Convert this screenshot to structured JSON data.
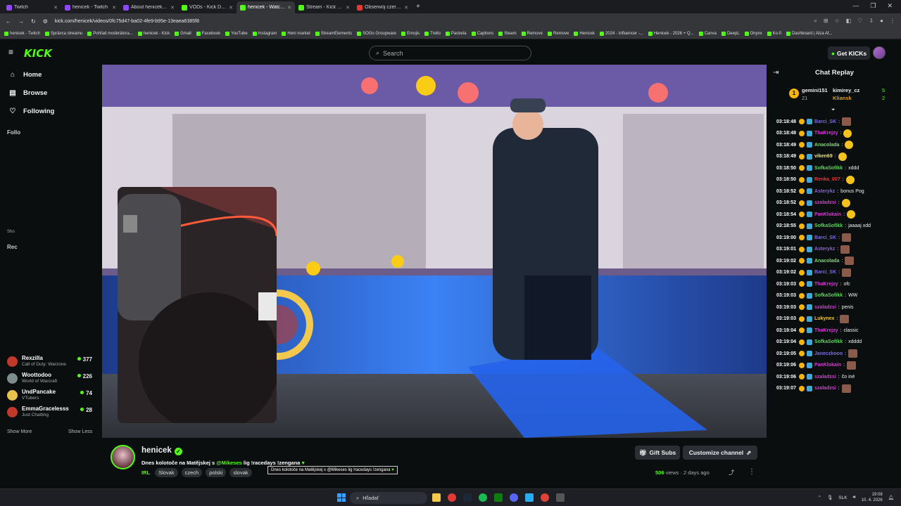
{
  "browser": {
    "tabs": [
      {
        "label": "Twitch",
        "color": "#9146ff"
      },
      {
        "label": "henicek - Twitch",
        "color": "#9146ff"
      },
      {
        "label": "About henicek - Watch Li",
        "color": "#9146ff"
      },
      {
        "label": "VODs - Kick Dashboard",
        "color": "#53fc18"
      },
      {
        "label": "henicek - Watch the V",
        "color": "#53fc18",
        "active": true
      },
      {
        "label": "Stream - Kick Dashboard",
        "color": "#53fc18"
      },
      {
        "label": "Obserwój czerwoną kropi",
        "color": "#e53935"
      }
    ],
    "url": "kick.com/henicek/videos/0fc75d47-ba02-4fe9-b95e-13eaea6385f8",
    "bookmarks": [
      "henicek - Twitch",
      "Správca streamu",
      "Pohľad moderátora...",
      "henicek - Kick",
      "Gmail",
      "Facebook",
      "YouTube",
      "Instagram",
      "Heni market",
      "StreamElements",
      "SOGo Groupware",
      "Emojis",
      "Trello",
      "Packeta",
      "Captions",
      "Steam",
      "Remove",
      "Remove",
      "Henicek",
      "2024 - Influencer -...",
      "Henicek - 2026 + Q...",
      "Canva",
      "DeepL",
      "Onyxx",
      "Ko-fi",
      "Dashboard | Alza Af..."
    ]
  },
  "header": {
    "logo": "KICK",
    "search_placeholder": "Search",
    "get_kicks_label": "Get KICKs"
  },
  "sidebar": {
    "nav": [
      {
        "label": "Home",
        "icon": "home-icon"
      },
      {
        "label": "Browse",
        "icon": "browse-icon"
      },
      {
        "label": "Following",
        "icon": "heart-icon"
      }
    ],
    "following_header": "Follo",
    "recommended_header": "Rec",
    "show_short": "Sho",
    "channels": [
      {
        "name": "Rexzilla",
        "game": "Call of Duty: Warzone",
        "viewers": "377",
        "color": "#c0392b"
      },
      {
        "name": "Woottodoo",
        "game": "World of Warcraft",
        "viewers": "226",
        "color": "#7f8c8d"
      },
      {
        "name": "UndPancake",
        "game": "VTubers",
        "viewers": "74",
        "color": "#e6c34a"
      },
      {
        "name": "EmmaGracelesss",
        "game": "Just Chatting",
        "viewers": "28",
        "color": "#c0392b"
      }
    ],
    "show_more": "Show More",
    "show_less": "Show Less"
  },
  "chat": {
    "title": "Chat Replay",
    "leader": {
      "top_name": "gemini151",
      "top_count": "21",
      "second": "kimirey_cz",
      "second_count": "5",
      "third": "Kliansk",
      "third_count": "2"
    },
    "messages": [
      {
        "time": "03:18:48",
        "user": "Barci_SK",
        "text": "",
        "color": "#7b68ee",
        "emote": "face"
      },
      {
        "time": "03:18:48",
        "user": "ThaKrejzy",
        "text": "",
        "color": "#d33dd3",
        "emote": "yellow"
      },
      {
        "time": "03:18:49",
        "user": "Anacolada",
        "text": "",
        "color": "#6ee05f",
        "emote": "yellow"
      },
      {
        "time": "03:18:49",
        "user": "viken69",
        "text": "",
        "color": "#e8e16b",
        "emote": "yellow"
      },
      {
        "time": "03:18:50",
        "user": "SofkaSofikk",
        "text": "xddd",
        "color": "#5fd35f",
        "emote": ""
      },
      {
        "time": "03:18:50",
        "user": "Renka_007",
        "text": "",
        "color": "#e53935",
        "emote": "yellow"
      },
      {
        "time": "03:18:52",
        "user": "Asterykz",
        "text": "bonus Pog",
        "color": "#8a63d2",
        "emote": ""
      },
      {
        "time": "03:18:52",
        "user": "szaladzsi",
        "text": "",
        "color": "#d33dd3",
        "emote": "yellow"
      },
      {
        "time": "03:18:54",
        "user": "PanKlokain",
        "text": "",
        "color": "#d33dd3",
        "emote": "yellow"
      },
      {
        "time": "03:18:55",
        "user": "SofkaSofikk",
        "text": "jaaaaj xdd",
        "color": "#5fd35f",
        "emote": ""
      },
      {
        "time": "03:19:00",
        "user": "Barci_SK",
        "text": "",
        "color": "#7b68ee",
        "emote": "face"
      },
      {
        "time": "03:19:01",
        "user": "Asterykz",
        "text": "",
        "color": "#8a63d2",
        "emote": "face"
      },
      {
        "time": "03:19:02",
        "user": "Anacolada",
        "text": "",
        "color": "#6ee05f",
        "emote": "face"
      },
      {
        "time": "03:19:02",
        "user": "Barci_SK",
        "text": "",
        "color": "#7b68ee",
        "emote": "face"
      },
      {
        "time": "03:19:03",
        "user": "ThaKrejzy",
        "text": "ofc",
        "color": "#d33dd3",
        "emote": ""
      },
      {
        "time": "03:19:03",
        "user": "SofkaSofikk",
        "text": "WW",
        "color": "#5fd35f",
        "emote": ""
      },
      {
        "time": "03:19:03",
        "user": "szaladzsi",
        "text": "penis",
        "color": "#d33dd3",
        "emote": ""
      },
      {
        "time": "03:19:03",
        "user": "Lukynex",
        "text": "",
        "color": "#e8c44a",
        "emote": "face"
      },
      {
        "time": "03:19:04",
        "user": "ThaKrejzy",
        "text": "classic",
        "color": "#d33dd3",
        "emote": ""
      },
      {
        "time": "03:19:04",
        "user": "SofkaSofikk",
        "text": "xdddd",
        "color": "#5fd35f",
        "emote": ""
      },
      {
        "time": "03:19:05",
        "user": "Janeczkooo",
        "text": "",
        "color": "#7b68ee",
        "emote": "face"
      },
      {
        "time": "03:19:06",
        "user": "PanKlokain",
        "text": "",
        "color": "#d33dd3",
        "emote": "face"
      },
      {
        "time": "03:19:06",
        "user": "szaladzsi",
        "text": "čo iné",
        "color": "#d33dd3",
        "emote": ""
      },
      {
        "time": "03:19:07",
        "user": "szaladzsi",
        "text": "",
        "color": "#d33dd3",
        "emote": "face"
      }
    ]
  },
  "video_info": {
    "channel": "henicek",
    "title_pre": "Dnes kolotoče na Matějskej s ",
    "mention": "@Mikeses",
    "title_post": " lig !racedays !zengana",
    "category": "IRL",
    "tags": [
      "Slovak",
      "czech",
      "polski",
      "slovak"
    ],
    "tooltip": "Dnes kolotoče na Matějskej s @Mikeses lig !racedays !zengana",
    "gift_subs": "Gift Subs",
    "customize": "Customize channel",
    "views_count": "506",
    "views_label": "views",
    "age": "2 days ago"
  },
  "taskbar": {
    "search": "Hľadať",
    "lang": "SLK",
    "time": "19:08",
    "date": "10. 4. 2026"
  }
}
